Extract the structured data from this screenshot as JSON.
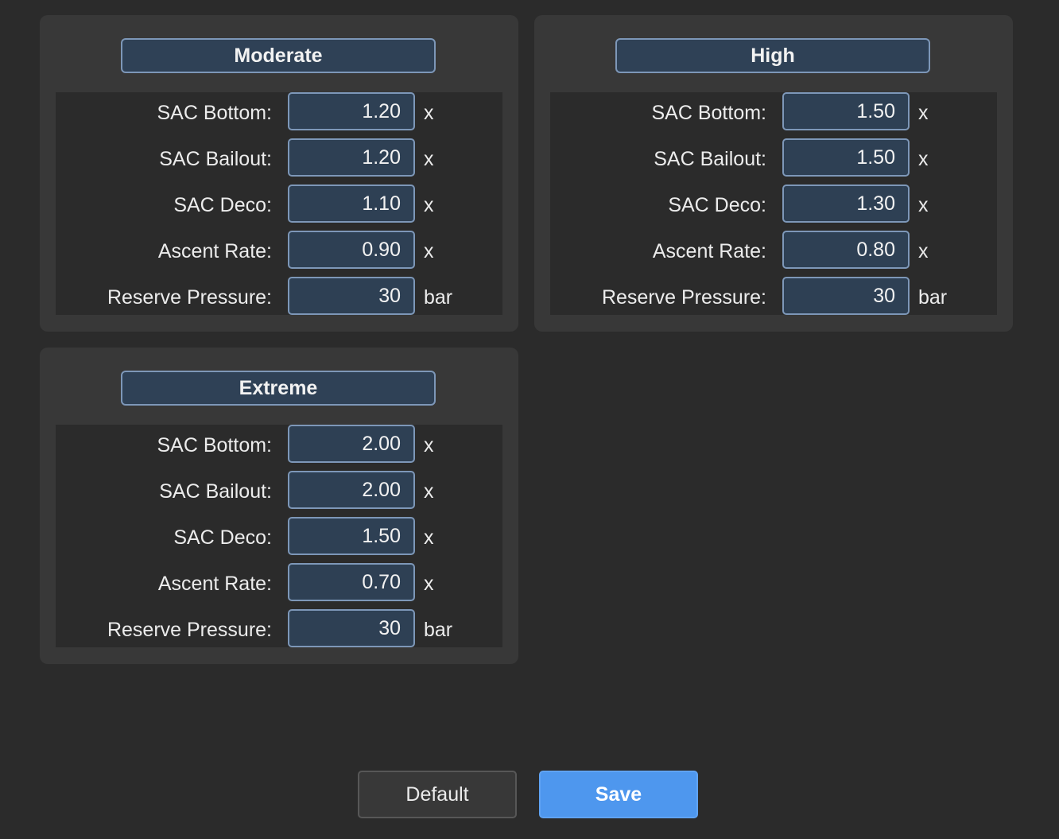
{
  "profiles": [
    {
      "title": "Moderate",
      "rows": [
        {
          "label": "SAC Bottom:",
          "value": "1.20",
          "unit": "x"
        },
        {
          "label": "SAC Bailout:",
          "value": "1.20",
          "unit": "x"
        },
        {
          "label": "SAC Deco:",
          "value": "1.10",
          "unit": "x"
        },
        {
          "label": "Ascent Rate:",
          "value": "0.90",
          "unit": "x"
        },
        {
          "label": "Reserve Pressure:",
          "value": "30",
          "unit": "bar"
        }
      ]
    },
    {
      "title": "High",
      "rows": [
        {
          "label": "SAC Bottom:",
          "value": "1.50",
          "unit": "x"
        },
        {
          "label": "SAC Bailout:",
          "value": "1.50",
          "unit": "x"
        },
        {
          "label": "SAC Deco:",
          "value": "1.30",
          "unit": "x"
        },
        {
          "label": "Ascent Rate:",
          "value": "0.80",
          "unit": "x"
        },
        {
          "label": "Reserve Pressure:",
          "value": "30",
          "unit": "bar"
        }
      ]
    },
    {
      "title": "Extreme",
      "rows": [
        {
          "label": "SAC Bottom:",
          "value": "2.00",
          "unit": "x"
        },
        {
          "label": "SAC Bailout:",
          "value": "2.00",
          "unit": "x"
        },
        {
          "label": "SAC Deco:",
          "value": "1.50",
          "unit": "x"
        },
        {
          "label": "Ascent Rate:",
          "value": "0.70",
          "unit": "x"
        },
        {
          "label": "Reserve Pressure:",
          "value": "30",
          "unit": "bar"
        }
      ]
    }
  ],
  "actions": {
    "default_label": "Default",
    "save_label": "Save"
  },
  "colors": {
    "accent": "#4e97ee",
    "field_background": "#2e4054",
    "field_border": "#7d97b8",
    "panel_background": "#383838",
    "window_background": "#2b2b2b"
  }
}
